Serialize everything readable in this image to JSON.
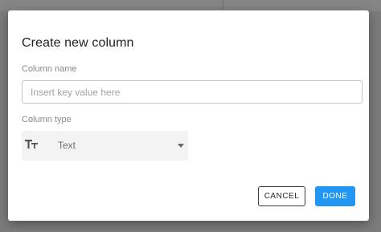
{
  "dialog": {
    "title": "Create new column",
    "column_name": {
      "label": "Column name",
      "value": "",
      "placeholder": "Insert key value here"
    },
    "column_type": {
      "label": "Column type",
      "selected": "Text",
      "icon": "text-type-icon"
    },
    "buttons": {
      "cancel_label": "CANCEL",
      "done_label": "DONE"
    }
  },
  "colors": {
    "primary": "#2196f3",
    "overlay": "#7c7c7c",
    "select_bg": "#f3f3f3"
  }
}
